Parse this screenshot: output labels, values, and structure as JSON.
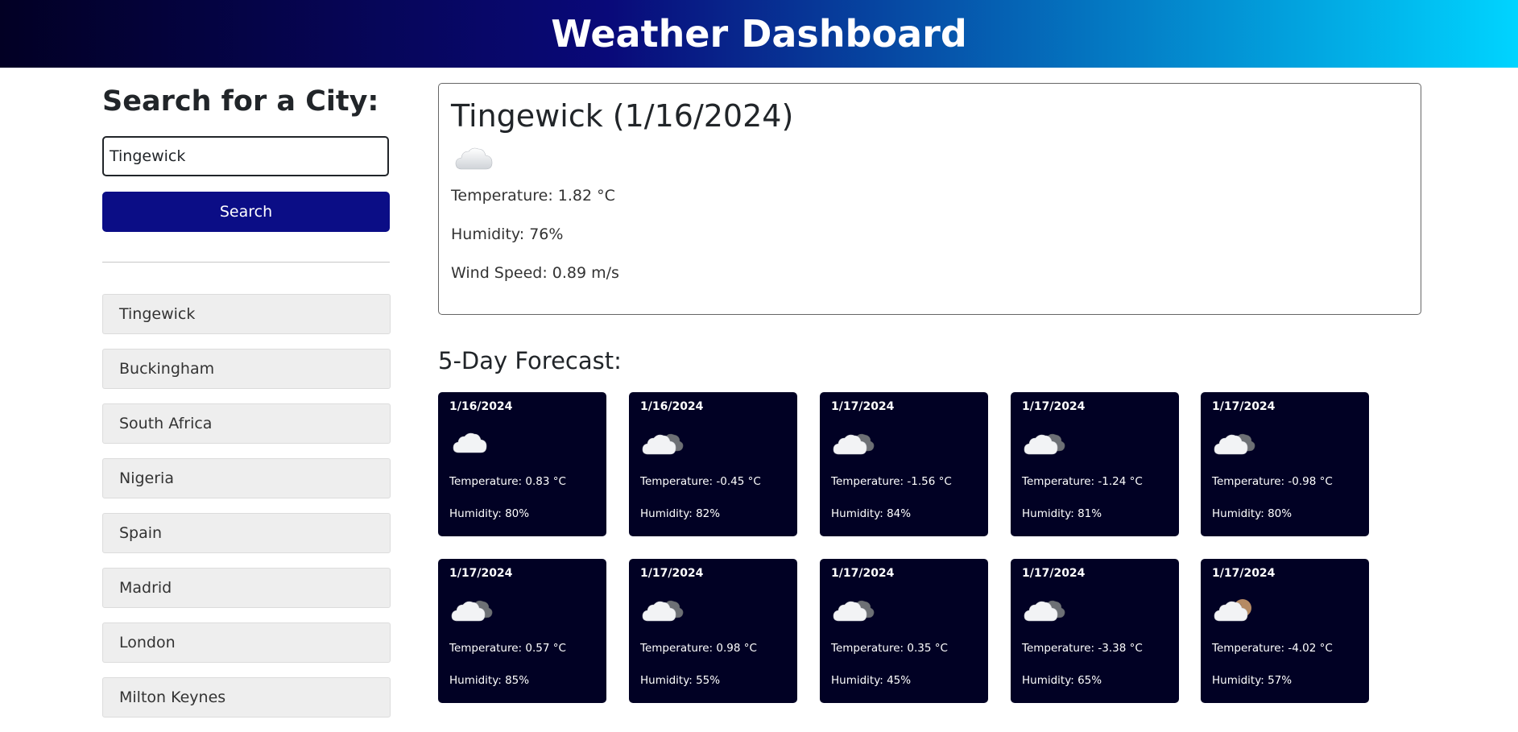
{
  "header": {
    "title": "Weather Dashboard"
  },
  "sidebar": {
    "heading": "Search for a City:",
    "search_value": "Tingewick",
    "search_button": "Search",
    "history": [
      "Tingewick",
      "Buckingham",
      "South Africa",
      "Nigeria",
      "Spain",
      "Madrid",
      "London",
      "Milton Keynes"
    ]
  },
  "current": {
    "title": "Tingewick (1/16/2024)",
    "icon": "cloud-icon",
    "temperature": "Temperature: 1.82 °C",
    "humidity": "Humidity: 76%",
    "wind": "Wind Speed: 0.89 m/s"
  },
  "forecast": {
    "title": "5-Day Forecast:",
    "cards": [
      {
        "date": "1/16/2024",
        "icon": "cloud-icon",
        "temp": "Temperature: 0.83 °C",
        "humidity": "Humidity: 80%"
      },
      {
        "date": "1/16/2024",
        "icon": "broken-clouds-icon",
        "temp": "Temperature: -0.45 °C",
        "humidity": "Humidity: 82%"
      },
      {
        "date": "1/17/2024",
        "icon": "broken-clouds-icon",
        "temp": "Temperature: -1.56 °C",
        "humidity": "Humidity: 84%"
      },
      {
        "date": "1/17/2024",
        "icon": "broken-clouds-icon",
        "temp": "Temperature: -1.24 °C",
        "humidity": "Humidity: 81%"
      },
      {
        "date": "1/17/2024",
        "icon": "broken-clouds-icon",
        "temp": "Temperature: -0.98 °C",
        "humidity": "Humidity: 80%"
      },
      {
        "date": "1/17/2024",
        "icon": "broken-clouds-icon",
        "temp": "Temperature: 0.57 °C",
        "humidity": "Humidity: 85%"
      },
      {
        "date": "1/17/2024",
        "icon": "broken-clouds-icon",
        "temp": "Temperature: 0.98 °C",
        "humidity": "Humidity: 55%"
      },
      {
        "date": "1/17/2024",
        "icon": "broken-clouds-icon",
        "temp": "Temperature: 0.35 °C",
        "humidity": "Humidity: 45%"
      },
      {
        "date": "1/17/2024",
        "icon": "broken-clouds-icon",
        "temp": "Temperature: -3.38 °C",
        "humidity": "Humidity: 65%"
      },
      {
        "date": "1/17/2024",
        "icon": "few-clouds-night-icon",
        "temp": "Temperature: -4.02 °C",
        "humidity": "Humidity: 57%"
      }
    ]
  },
  "colors": {
    "header_gradient": [
      "#020024",
      "#090979",
      "#00d4ff"
    ],
    "search_button": "#0b0d86",
    "card_background": "#010124",
    "history_background": "#eeeeee"
  }
}
